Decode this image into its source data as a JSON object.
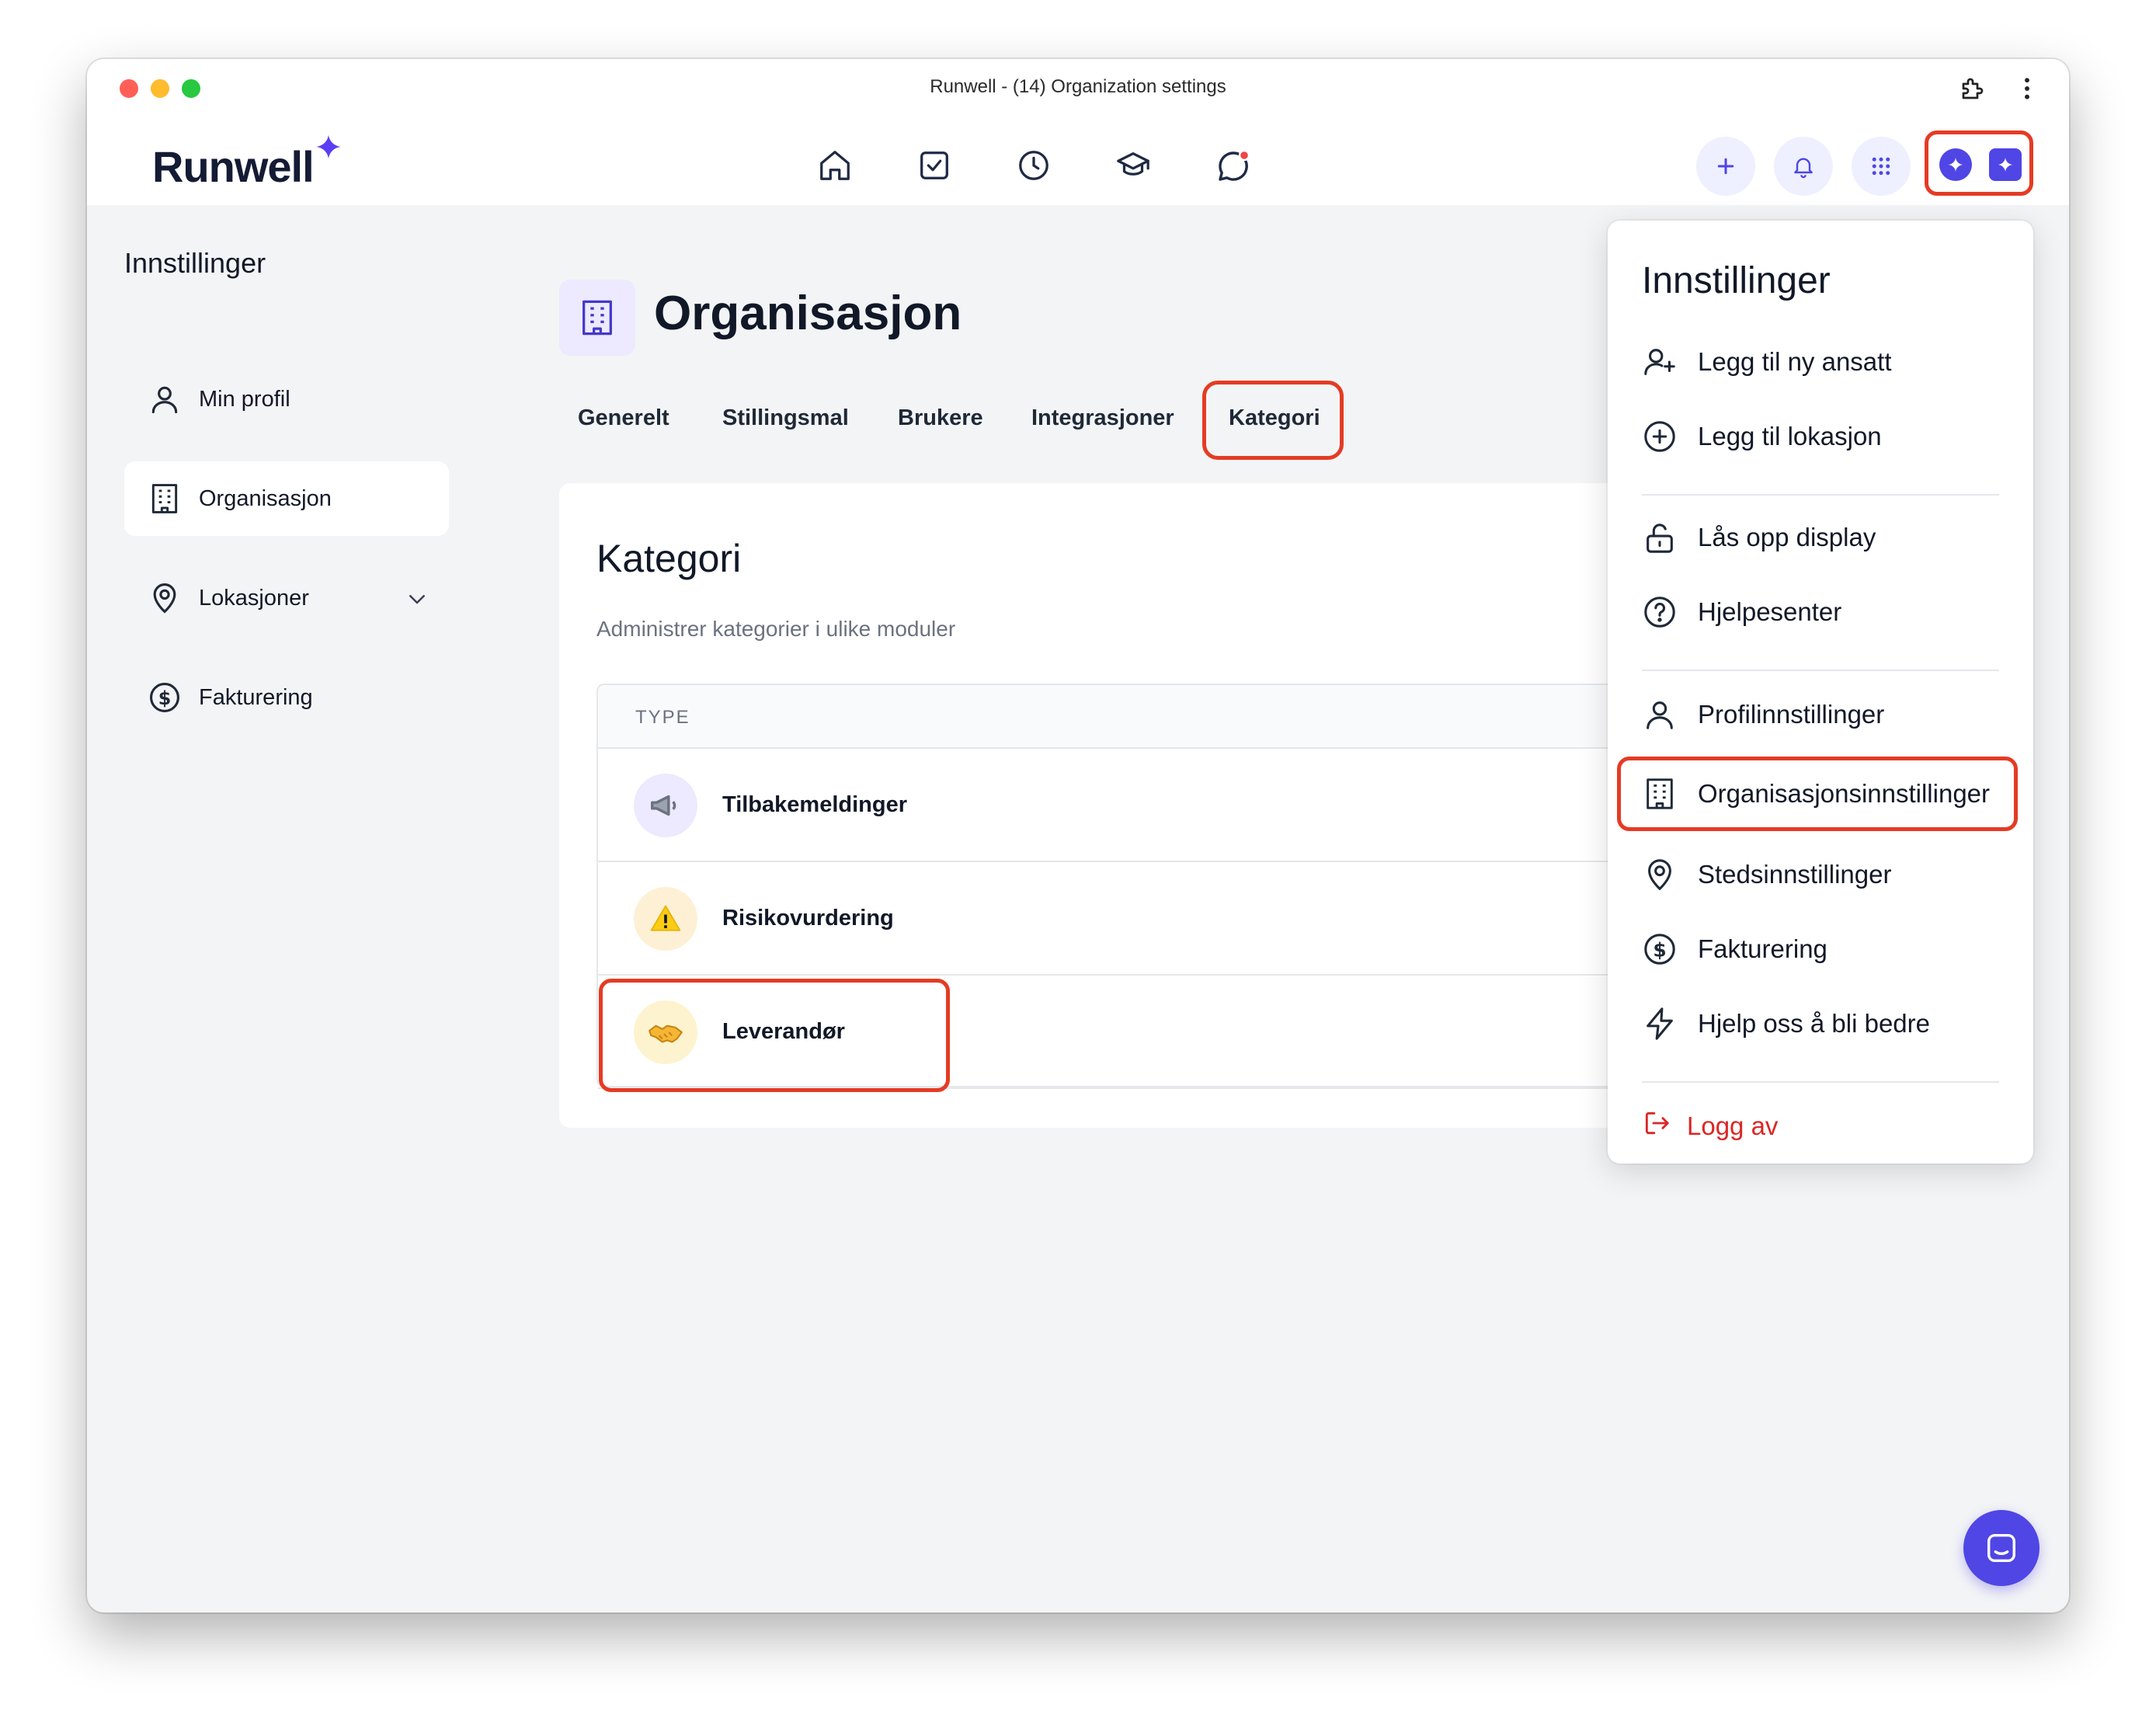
{
  "window": {
    "title": "Runwell - (14) Organization settings"
  },
  "header": {
    "logo": "Runwell",
    "nav": [
      "home-icon",
      "task-check-icon",
      "clock-icon",
      "graduation-cap-icon",
      "chat-bubble-icon"
    ],
    "actions": [
      "plus-icon",
      "bell-icon",
      "apps-grid-icon",
      "ai-sparkle-icon"
    ]
  },
  "sidebar": {
    "title": "Innstillinger",
    "items": [
      {
        "label": "Min profil",
        "icon": "user-icon"
      },
      {
        "label": "Organisasjon",
        "icon": "building-icon",
        "active": true
      },
      {
        "label": "Lokasjoner",
        "icon": "map-pin-icon",
        "expandable": true
      },
      {
        "label": "Fakturering",
        "icon": "dollar-circle-icon"
      }
    ]
  },
  "main": {
    "title": "Organisasjon",
    "tabs": [
      {
        "label": "Generelt"
      },
      {
        "label": "Stillingsmal"
      },
      {
        "label": "Brukere"
      },
      {
        "label": "Integrasjoner"
      },
      {
        "label": "Kategori",
        "active": true
      }
    ],
    "card": {
      "title": "Kategori",
      "subtitle": "Administrer kategorier i ulike moduler",
      "column_header": "TYPE",
      "rows": [
        {
          "label": "Tilbakemeldinger",
          "emoji": "📢",
          "bg": "#ede9fe"
        },
        {
          "label": "Risikovurdering",
          "emoji": "⚠️",
          "bg": "#fdf0d5"
        },
        {
          "label": "Leverandør",
          "emoji": "🤝",
          "bg": "#fdf3cf"
        }
      ]
    }
  },
  "dropdown": {
    "title": "Innstillinger",
    "items": [
      {
        "label": "Legg til ny ansatt",
        "icon": "user-plus-icon"
      },
      {
        "label": "Legg til lokasjon",
        "icon": "plus-circle-icon"
      },
      {
        "label": "Lås opp display",
        "icon": "unlock-icon"
      },
      {
        "label": "Hjelpesenter",
        "icon": "help-circle-icon"
      },
      {
        "label": "Profilinnstillinger",
        "icon": "user-icon"
      },
      {
        "label": "Organisasjonsinnstillinger",
        "icon": "building-icon",
        "highlighted": true
      },
      {
        "label": "Stedsinnstillinger",
        "icon": "map-pin-icon"
      },
      {
        "label": "Fakturering",
        "icon": "dollar-circle-icon"
      },
      {
        "label": "Hjelp oss å bli bedre",
        "icon": "lightning-icon"
      }
    ],
    "logout": {
      "label": "Logg av",
      "icon": "logout-icon"
    }
  },
  "colors": {
    "accent": "#4f46e5",
    "highlight": "#e53b24",
    "logout": "#dc2626",
    "notification": "#ef4444"
  }
}
